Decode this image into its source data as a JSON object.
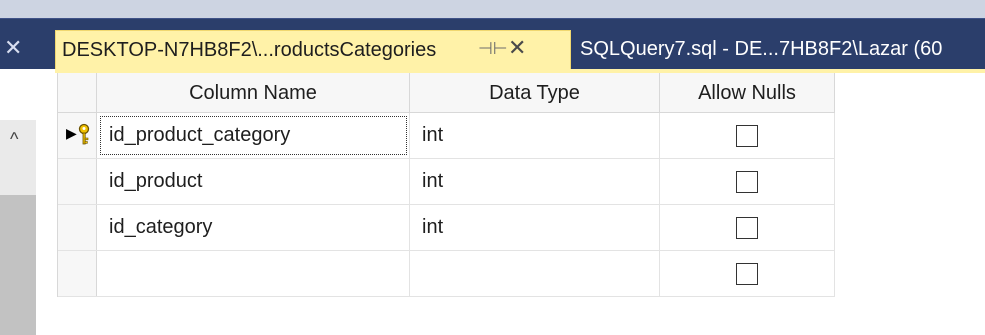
{
  "tabs": [
    {
      "label": "DESKTOP-N7HB8F2\\...roductsCategories",
      "active": true,
      "pin_icon": "pin-icon",
      "close_icon": "close-icon"
    },
    {
      "label": "SQLQuery7.sql - DE...7HB8F2\\Lazar (60",
      "active": false
    }
  ],
  "left_close_glyph": "✕",
  "grid": {
    "headers": [
      "Column Name",
      "Data Type",
      "Allow Nulls"
    ],
    "rows": [
      {
        "column_name": "id_product_category",
        "data_type": "int",
        "allow_nulls": false,
        "primary_key": true,
        "current": true
      },
      {
        "column_name": "id_product",
        "data_type": "int",
        "allow_nulls": false,
        "primary_key": false,
        "current": false
      },
      {
        "column_name": "id_category",
        "data_type": "int",
        "allow_nulls": false,
        "primary_key": false,
        "current": false
      },
      {
        "column_name": "",
        "data_type": "",
        "allow_nulls": false,
        "primary_key": false,
        "current": false
      }
    ]
  },
  "colors": {
    "active_tab": "#fff2a8",
    "tab_bar": "#2b3e6b"
  }
}
